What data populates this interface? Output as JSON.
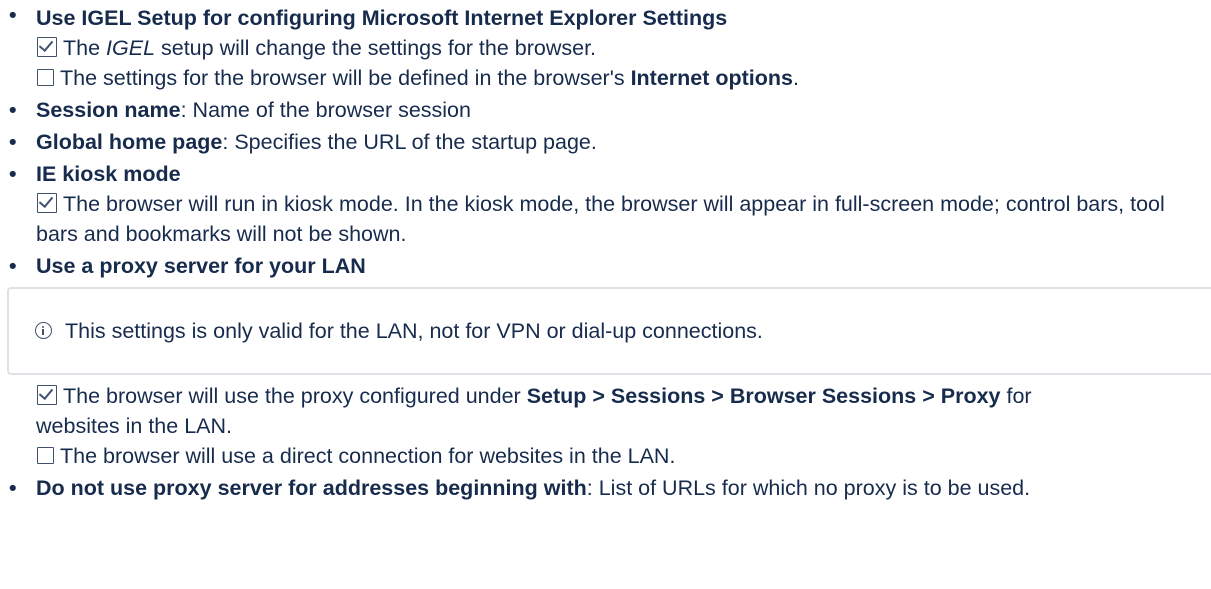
{
  "items": [
    {
      "heading": "Use IGEL Setup for configuring Microsoft Internet Explorer Settings",
      "checked_pre": "The ",
      "checked_em": "IGEL",
      "checked_post": " setup will change the settings for the browser.",
      "unchecked_pre": "The settings for the browser will be defined in the browser's ",
      "unchecked_bold": "Internet options",
      "unchecked_post": "."
    },
    {
      "heading": "Session name",
      "desc": ": Name of the browser session"
    },
    {
      "heading": "Global home page",
      "desc": ": Specifies the URL of the startup page."
    },
    {
      "heading": "IE kiosk mode",
      "checked_text": "The browser will run in kiosk mode. In the kiosk mode, the browser will appear in full-screen mode; control bars, tool bars and bookmarks will not be shown."
    },
    {
      "heading": "Use a proxy server for your LAN",
      "info_note": "This settings is only valid for the LAN, not for VPN or dial-up connections.",
      "checked_pre": "The browser will use the proxy configured under ",
      "checked_bold": "Setup > Sessions > Browser Sessions > Proxy",
      "checked_post": " for websites in the LAN.",
      "unchecked_text": "The browser will use a direct connection for websites in the LAN."
    },
    {
      "heading": "Do not use proxy server for addresses beginning with",
      "desc": ": List of URLs for which no proxy is to be used."
    }
  ],
  "bullet_glyph": "•",
  "icons": {
    "checked": "checkbox-checked-icon",
    "unchecked": "checkbox-empty-icon",
    "info": "info-icon"
  }
}
